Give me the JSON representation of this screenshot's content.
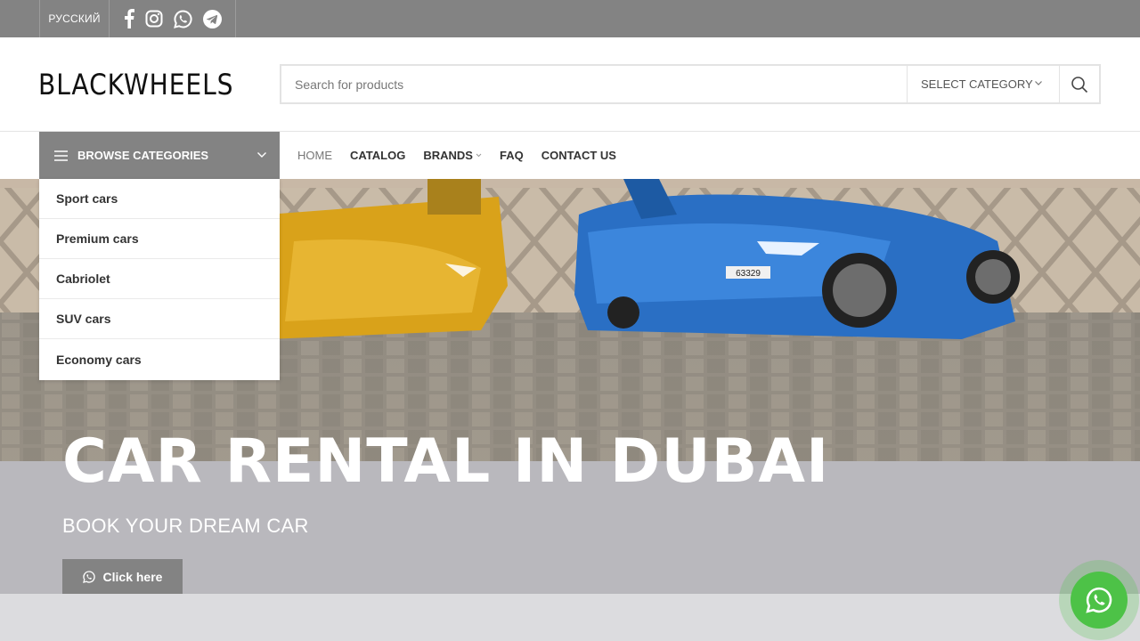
{
  "topbar": {
    "language": "РУССКИЙ",
    "social_icons": [
      "facebook-icon",
      "instagram-icon",
      "whatsapp-icon",
      "telegram-icon"
    ]
  },
  "header": {
    "logo": "BLACKWHEELS",
    "search_placeholder": "Search for products",
    "category_select": "SELECT CATEGORY"
  },
  "nav": {
    "browse_label": "BROWSE CATEGORIES",
    "items": [
      "HOME",
      "CATALOG",
      "BRANDS",
      "FAQ",
      "CONTACT US"
    ]
  },
  "categories": [
    "Sport cars",
    "Premium cars",
    "Cabriolet",
    "SUV cars",
    "Economy cars"
  ],
  "hero": {
    "title": "CAR RENTAL IN DUBAI",
    "subtitle": "BOOK YOUR DREAM CAR",
    "button": "Click here",
    "plate": "63329"
  },
  "colors": {
    "accent": "#838383",
    "whatsapp": "#4dc247",
    "blue_car": "#2a6fc4",
    "yellow_car": "#d9a21a"
  }
}
